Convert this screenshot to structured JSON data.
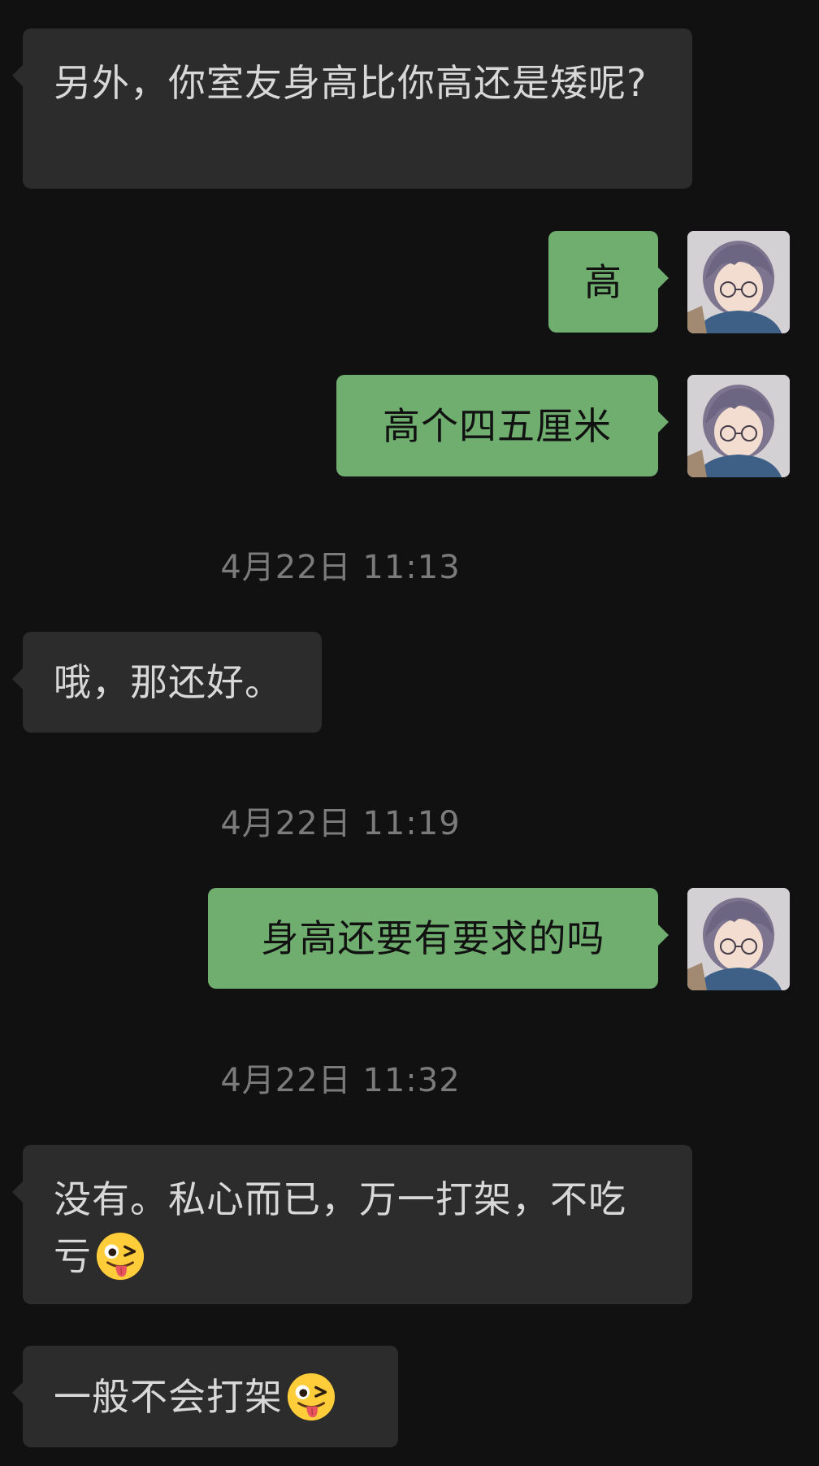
{
  "messages": [
    {
      "id": "m1",
      "side": "in",
      "text": "另外，你室友身高比你高还是矮呢?"
    },
    {
      "id": "m2",
      "side": "out",
      "text": "高"
    },
    {
      "id": "m3",
      "side": "out",
      "text": "高个四五厘米"
    },
    {
      "id": "t1",
      "type": "timestamp",
      "text": "4月22日 11:13"
    },
    {
      "id": "m4",
      "side": "in",
      "text": "哦，那还好。"
    },
    {
      "id": "t2",
      "type": "timestamp",
      "text": "4月22日 11:19"
    },
    {
      "id": "m5",
      "side": "out",
      "text": "身高还要有要求的吗"
    },
    {
      "id": "t3",
      "type": "timestamp",
      "text": "4月22日 11:32"
    },
    {
      "id": "m6",
      "side": "in",
      "text": "没有。私心而已，万一打架，不吃亏",
      "emoji": "winking-face-with-tongue-emoji"
    },
    {
      "id": "m7",
      "side": "in",
      "text": "一般不会打架",
      "emoji": "winking-face-with-tongue-emoji"
    }
  ],
  "colors": {
    "background": "#111111",
    "incoming_bubble": "#2c2c2c",
    "outgoing_bubble": "#6fae6f",
    "timestamp_text": "#7b7b7b"
  },
  "avatar": {
    "icon": "anime-avatar-icon"
  }
}
